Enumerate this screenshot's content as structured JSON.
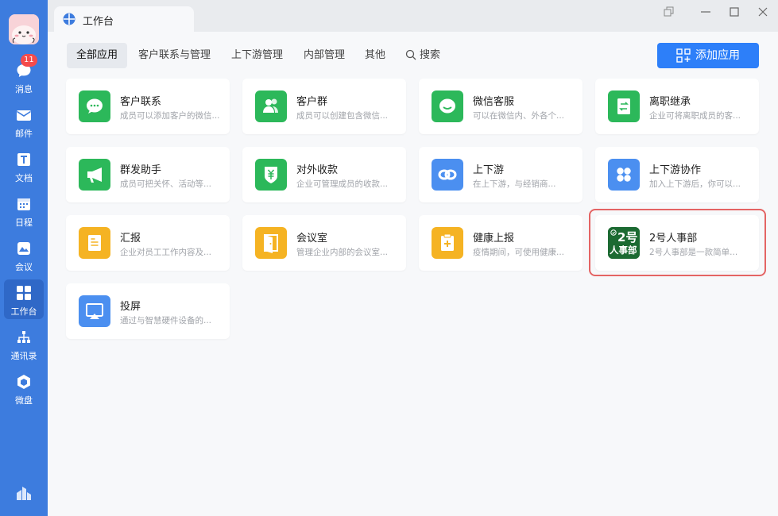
{
  "sidebar": {
    "items": [
      {
        "label": "消息",
        "icon": "chat-bubble-icon",
        "badge": "11"
      },
      {
        "label": "邮件",
        "icon": "mail-icon"
      },
      {
        "label": "文档",
        "icon": "document-icon"
      },
      {
        "label": "日程",
        "icon": "calendar-icon"
      },
      {
        "label": "会议",
        "icon": "meeting-icon"
      },
      {
        "label": "工作台",
        "icon": "workbench-grid-icon",
        "active": true
      },
      {
        "label": "通讯录",
        "icon": "contacts-tree-icon"
      },
      {
        "label": "微盘",
        "icon": "cloud-drive-icon"
      }
    ],
    "bottom_icon": "settings-building-icon"
  },
  "window": {
    "tab_title": "工作台"
  },
  "categories": {
    "all": "全部应用",
    "customer": "客户联系与管理",
    "supply_chain": "上下游管理",
    "internal": "内部管理",
    "other": "其他",
    "search": "搜索"
  },
  "add_app_label": "添加应用",
  "apps": [
    {
      "name": "客户联系",
      "desc": "成员可以添加客户的微信...",
      "icon": "wechat-chat-icon",
      "color": "#2cb85a"
    },
    {
      "name": "客户群",
      "desc": "成员可以创建包含微信...",
      "icon": "customer-group-icon",
      "color": "#2cb85a"
    },
    {
      "name": "微信客服",
      "desc": "可以在微信内、外各个...",
      "icon": "wechat-service-icon",
      "color": "#2cb85a"
    },
    {
      "name": "离职继承",
      "desc": "企业可将离职成员的客...",
      "icon": "transfer-doc-icon",
      "color": "#2cb85a"
    },
    {
      "name": "群发助手",
      "desc": "成员可把关怀、活动等...",
      "icon": "megaphone-icon",
      "color": "#2cb85a"
    },
    {
      "name": "对外收款",
      "desc": "企业可管理成员的收款...",
      "icon": "yuan-shield-icon",
      "color": "#2cb85a"
    },
    {
      "name": "上下游",
      "desc": "在上下游，与经销商...",
      "icon": "chain-link-icon",
      "color": "#4b8ff0"
    },
    {
      "name": "上下游协作",
      "desc": "加入上下游后，你可以...",
      "icon": "four-dots-icon",
      "color": "#4b8ff0"
    },
    {
      "name": "汇报",
      "desc": "企业对员工工作内容及...",
      "icon": "report-icon",
      "color": "#f5b323"
    },
    {
      "name": "会议室",
      "desc": "管理企业内部的会议室...",
      "icon": "door-icon",
      "color": "#f5b323"
    },
    {
      "name": "健康上报",
      "desc": "疫情期间，可使用健康...",
      "icon": "health-clipboard-icon",
      "color": "#f5b323"
    },
    {
      "name": "2号人事部",
      "desc": "2号人事部是一款简单...",
      "icon": "hr-logo-icon",
      "color": "#1c6a32",
      "logo_text": [
        "2号",
        "人事部"
      ]
    },
    {
      "name": "投屏",
      "desc": "通过与智慧硬件设备的...",
      "icon": "screen-cast-icon",
      "color": "#4b8ff0"
    }
  ]
}
